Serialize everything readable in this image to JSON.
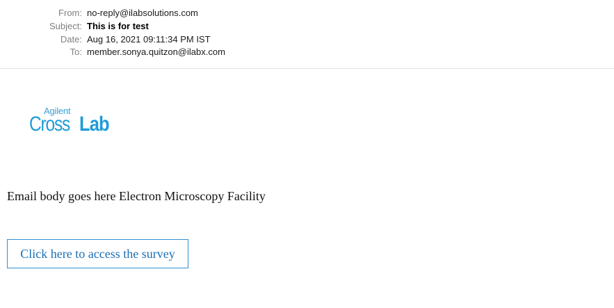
{
  "header": {
    "from_label": "From:",
    "from_value": "no-reply@ilabsolutions.com",
    "subject_label": "Subject:",
    "subject_value": "This is for test",
    "date_label": "Date:",
    "date_value": "Aug 16, 2021 09:11:34 PM IST",
    "to_label": "To:",
    "to_value": "member.sonya.quitzon@ilabx.com"
  },
  "logo": {
    "top_text": "Agilent",
    "main_text_light": "Cross",
    "main_text_bold": "Lab",
    "color": "#1f9bd8"
  },
  "email_body": {
    "text": "Email body goes here Electron Microscopy Facility"
  },
  "survey": {
    "button_label": "Click here to access the survey",
    "accent_color": "#2e8fd4"
  }
}
